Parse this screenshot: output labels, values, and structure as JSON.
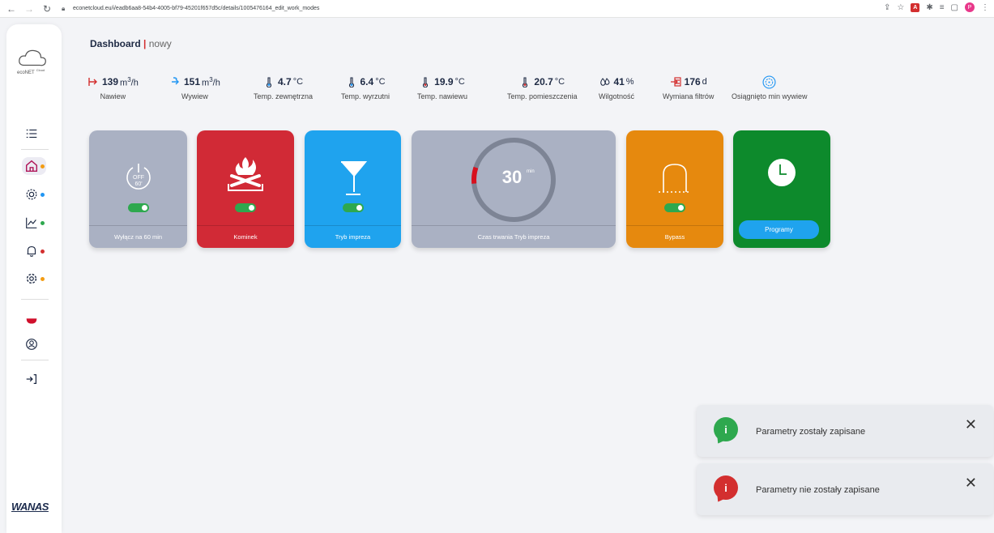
{
  "browser": {
    "url": "econetcloud.eu/i/eadb6aa8-54b4-4005-bf79-45201f657d5c/details/1005476164_edit_work_modes",
    "avatar_letter": "P"
  },
  "sidebar": {
    "logo_text": "ecoNET",
    "logo_sup": "Cloud",
    "brand": "WANAS",
    "status_colors": {
      "home": "#f39c12",
      "settings": "#2196f3",
      "charts": "#2ea84e",
      "alarms": "#d32f2f",
      "service": "#f39c12"
    }
  },
  "breadcrumb": {
    "main": "Dashboard",
    "separator": "|",
    "sub": "nowy"
  },
  "stats": [
    {
      "value": "139",
      "unit": "m³/h",
      "label": "Nawiew",
      "icon": "supply-arrow-icon"
    },
    {
      "value": "151",
      "unit": "m³/h",
      "label": "Wywiew",
      "icon": "exhaust-arrow-icon"
    },
    {
      "value": "4.7",
      "unit": "°C",
      "label": "Temp. zewnętrzna",
      "icon": "thermometer-icon"
    },
    {
      "value": "6.4",
      "unit": "°C",
      "label": "Temp. wyrzutni",
      "icon": "thermometer-icon"
    },
    {
      "value": "19.9",
      "unit": "°C",
      "label": "Temp. nawiewu",
      "icon": "thermometer-icon"
    },
    {
      "value": "20.7",
      "unit": "°C",
      "label": "Temp. pomieszczenia",
      "icon": "thermometer-icon"
    },
    {
      "value": "41",
      "unit": "%",
      "label": "Wilgotność",
      "icon": "humidity-icon"
    },
    {
      "value": "176",
      "unit": "d",
      "label": "Wymiana filtrów",
      "icon": "filter-icon"
    },
    {
      "value": "",
      "unit": "",
      "label": "Osiągnięto min wywiew",
      "icon": "fan-icon"
    }
  ],
  "cards": {
    "off60": {
      "label": "Wyłącz na 60 min",
      "icon_text_top": "OFF",
      "icon_text_bottom": "60'",
      "enabled": true,
      "color": "#aab1c3"
    },
    "fireplace": {
      "label": "Kominek",
      "enabled": true,
      "color": "#d12a36"
    },
    "party": {
      "label": "Tryb impreza",
      "enabled": true,
      "color": "#1fa3ee"
    },
    "duration": {
      "label": "Czas trwania Tryb impreza",
      "value": "30",
      "unit": "min",
      "progress": 0.1,
      "color": "#aab1c3"
    },
    "bypass": {
      "label": "Bypass",
      "enabled": true,
      "color": "#e6890e"
    },
    "programs": {
      "button_label": "Programy",
      "color": "#0d8a2c"
    }
  },
  "toasts": [
    {
      "text": "Parametry zostały zapisane",
      "color": "#2ea84e"
    },
    {
      "text": "Parametry nie zostały zapisane",
      "color": "#d32f2f"
    }
  ]
}
